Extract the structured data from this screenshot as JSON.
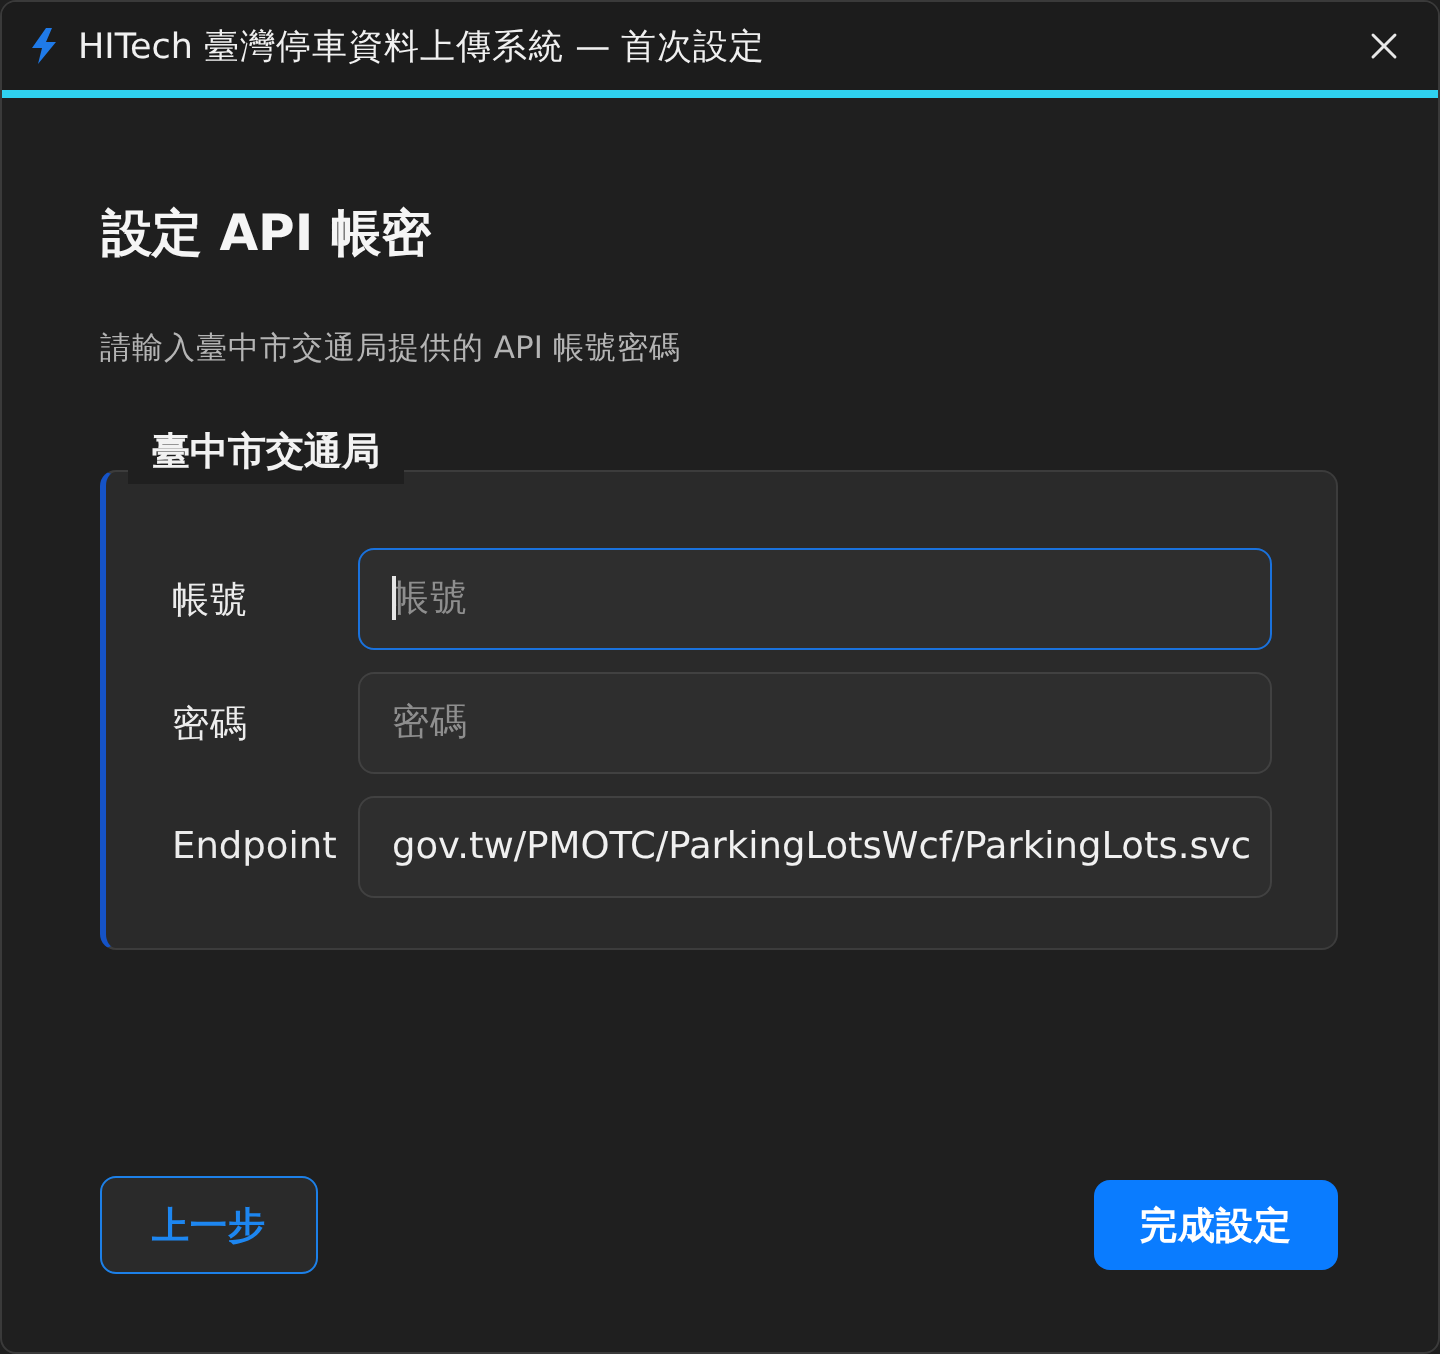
{
  "window": {
    "title": "HITech 臺灣停車資料上傳系統 — 首次設定"
  },
  "page": {
    "heading": "設定 API 帳密",
    "description": "請輸入臺中市交通局提供的 API 帳號密碼"
  },
  "group": {
    "legend": "臺中市交通局",
    "fields": [
      {
        "label": "帳號",
        "placeholder": "帳號",
        "focused": true
      },
      {
        "label": "密碼",
        "placeholder": "密碼",
        "focused": false
      },
      {
        "label": "Endpoint",
        "value": "gov.tw/PMOTC/ParkingLotsWcf/ParkingLots.svc",
        "focused": false
      }
    ]
  },
  "buttons": [
    {
      "label": "上一步",
      "kind": "secondary"
    },
    {
      "label": "完成設定",
      "kind": "primary"
    }
  ]
}
